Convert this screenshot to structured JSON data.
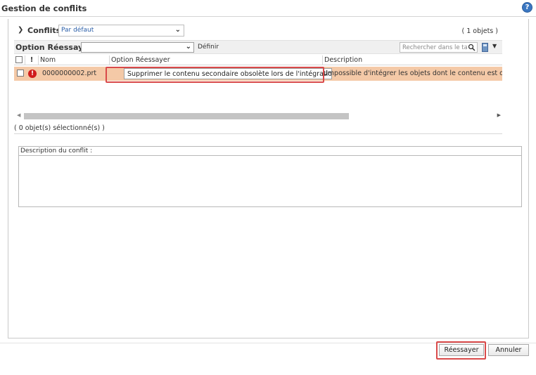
{
  "window": {
    "title": "Gestion de conflits",
    "help_icon": "?"
  },
  "conflicts": {
    "title": "Conflits",
    "view_selected": "Par défaut",
    "count": "( 1 objets )"
  },
  "toolbar": {
    "label": "Option Réessayer",
    "option_value": "",
    "define_label": "Définir",
    "search_placeholder": "Rechercher dans le tableau"
  },
  "table": {
    "headers": {
      "flag": "!",
      "name": "Nom",
      "option": "Option Réessayer",
      "description": "Description"
    },
    "rows": [
      {
        "name": "0000000002.prt",
        "option": "Supprimer le contenu secondaire obsolète lors de l'intégration",
        "description": "Impossible d'intégrer les objets dont le contenu est obsolète"
      }
    ]
  },
  "status": {
    "selected": "( 0 objet(s) sélectionné(s) )"
  },
  "description_panel": {
    "label": "Description du conflit :"
  },
  "buttons": {
    "retry": "Réessayer",
    "cancel": "Annuler"
  },
  "colors": {
    "row_highlight": "#f4c9a7",
    "error": "#d01b1b",
    "callout": "#d94a4a",
    "description_text": "#c84d3a"
  }
}
